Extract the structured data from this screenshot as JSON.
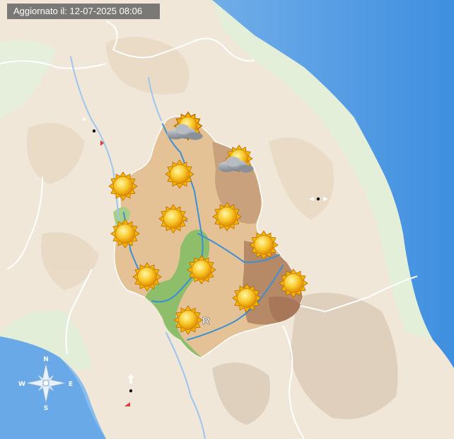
{
  "update": {
    "label": "Aggiornato il: 12-07-2025 08:06"
  },
  "colors": {
    "sea": "#5aa2e8",
    "land_light": "#f3e9da",
    "land_green": "#e1eed6",
    "region_tan": "#e6c598",
    "region_brown": "#c9a07a",
    "region_green": "#8fbf6a",
    "river": "#3a8fd6",
    "border": "#ffffff"
  },
  "compass": {
    "n": "N",
    "s": "S",
    "e": "E",
    "w": "W"
  },
  "labels": {
    "city_r": "R"
  },
  "forecast": {
    "icons": [
      {
        "name": "sun-icon",
        "type": "sunny"
      },
      {
        "name": "sun-icon",
        "type": "sunny"
      },
      {
        "name": "sun-icon",
        "type": "sunny"
      },
      {
        "name": "sun-icon",
        "type": "sunny"
      },
      {
        "name": "sun-icon",
        "type": "sunny"
      },
      {
        "name": "sun-icon",
        "type": "sunny"
      },
      {
        "name": "sun-icon",
        "type": "sunny"
      },
      {
        "name": "sun-icon",
        "type": "sunny"
      },
      {
        "name": "sun-icon",
        "type": "sunny"
      },
      {
        "name": "sun-icon",
        "type": "sunny"
      },
      {
        "name": "sun-icon",
        "type": "sunny"
      },
      {
        "name": "sun-icon",
        "type": "sunny"
      },
      {
        "name": "partly-cloudy-icon",
        "type": "partly-cloudy"
      },
      {
        "name": "partly-cloudy-icon",
        "type": "partly-cloudy"
      }
    ]
  }
}
